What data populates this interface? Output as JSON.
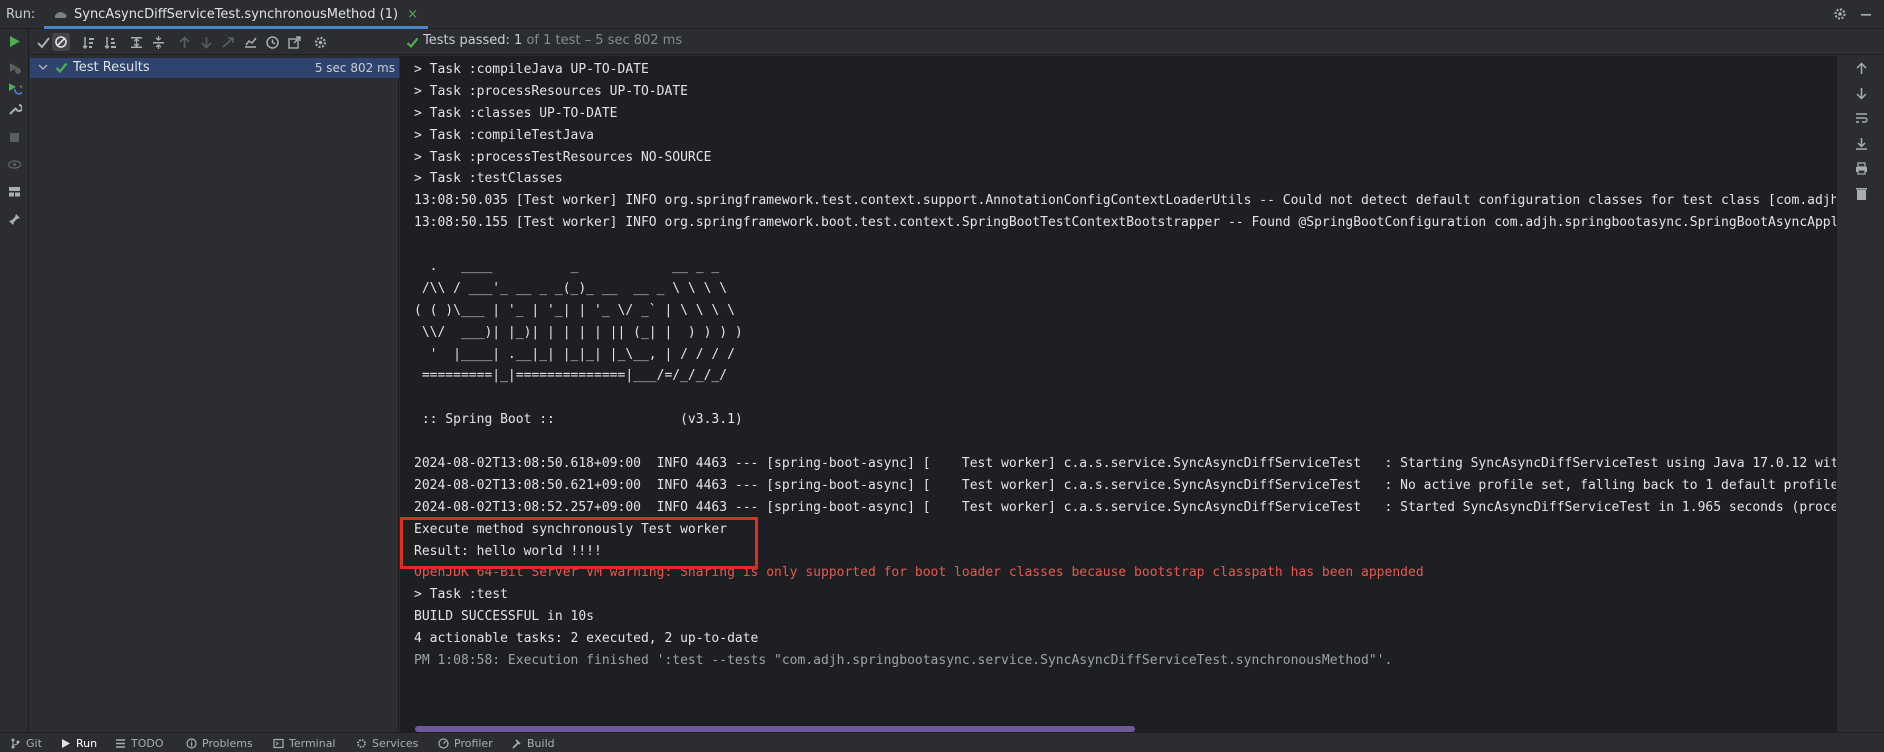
{
  "tabbar": {
    "run_label": "Run:",
    "tab_title": "SyncAsyncDiffServiceTest.synchronousMethod (1)",
    "close_glyph": "×"
  },
  "status": {
    "label": "Tests passed:",
    "count": "1",
    "detail": "of 1 test – 5 sec 802 ms"
  },
  "tree": {
    "root_label": "Test Results",
    "root_duration": "5 sec 802 ms"
  },
  "console": {
    "lines": [
      "> Task :compileJava UP-TO-DATE",
      "> Task :processResources UP-TO-DATE",
      "> Task :classes UP-TO-DATE",
      "> Task :compileTestJava",
      "> Task :processTestResources NO-SOURCE",
      "> Task :testClasses",
      "13:08:50.035 [Test worker] INFO org.springframework.test.context.support.AnnotationConfigContextLoaderUtils -- Could not detect default configuration classes for test class [com.adjh",
      "13:08:50.155 [Test worker] INFO org.springframework.boot.test.context.SpringBootTestContextBootstrapper -- Found @SpringBootConfiguration com.adjh.springbootasync.SpringBootAsyncAppli",
      "",
      "  .   ____          _            __ _ _",
      " /\\\\ / ___'_ __ _ _(_)_ __  __ _ \\ \\ \\ \\",
      "( ( )\\___ | '_ | '_| | '_ \\/ _` | \\ \\ \\ \\",
      " \\\\/  ___)| |_)| | | | | || (_| |  ) ) ) )",
      "  '  |____| .__|_| |_|_| |_\\__, | / / / /",
      " =========|_|==============|___/=/_/_/_/",
      "",
      " :: Spring Boot ::                (v3.3.1)",
      "",
      "2024-08-02T13:08:50.618+09:00  INFO 4463 --- [spring-boot-async] [    Test worker] c.a.s.service.SyncAsyncDiffServiceTest   : Starting SyncAsyncDiffServiceTest using Java 17.0.12 with",
      "2024-08-02T13:08:50.621+09:00  INFO 4463 --- [spring-boot-async] [    Test worker] c.a.s.service.SyncAsyncDiffServiceTest   : No active profile set, falling back to 1 default profile",
      "2024-08-02T13:08:52.257+09:00  INFO 4463 --- [spring-boot-async] [    Test worker] c.a.s.service.SyncAsyncDiffServiceTest   : Started SyncAsyncDiffServiceTest in 1.965 seconds (proces",
      "Execute method synchronously Test worker",
      "Result: hello world !!!!",
      "OpenJDK 64-Bit Server VM warning: Sharing is only supported for boot loader classes because bootstrap classpath has been appended",
      "> Task :test",
      "BUILD SUCCESSFUL in 10s",
      "4 actionable tasks: 2 executed, 2 up-to-date",
      "PM 1:08:58: Execution finished ':test --tests \"com.adjh.springbootasync.service.SyncAsyncDiffServiceTest.synchronousMethod\"'."
    ]
  },
  "bottombar": {
    "items": [
      "Git",
      "Run",
      "TODO",
      "Problems",
      "Terminal",
      "Services",
      "Profiler",
      "Build"
    ]
  },
  "colors": {
    "pass_green": "#4cae4f",
    "error_red": "#e8564f",
    "highlight_box": "#e02b20",
    "selection": "#2e436e",
    "accent_tab": "#4a88c7"
  },
  "icons": {
    "tab": "test-tab-icon",
    "status": "check-icon",
    "tree": "check-icon"
  }
}
